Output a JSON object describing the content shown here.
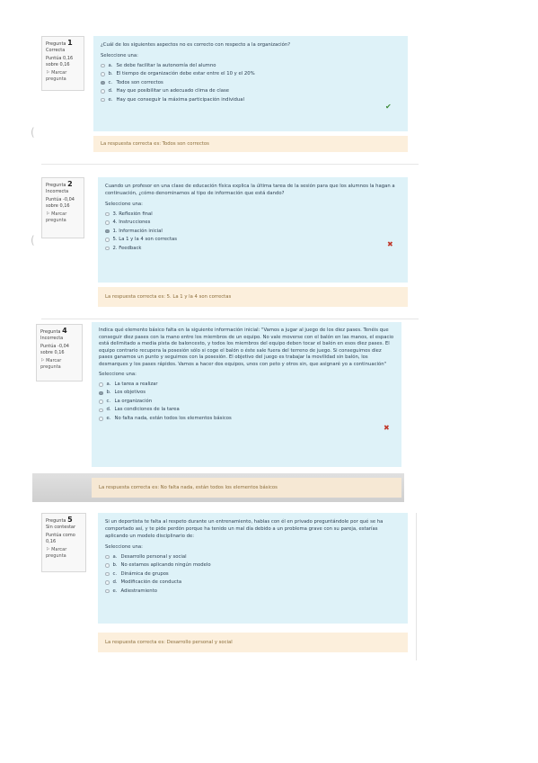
{
  "questions": [
    {
      "number": "1",
      "label": "Pregunta",
      "state": "Correcta",
      "grade": "Puntúa 0,16 sobre 0,16",
      "flag": "Marcar pregunta",
      "prompt": "¿Cuál de los siguientes aspectos no es correcto con respecto a la organización?",
      "select_label": "Seleccione una:",
      "options": [
        {
          "letter": "a.",
          "text": "Se debe facilitar la autonomía del alumno"
        },
        {
          "letter": "b.",
          "text": "El tiempo de organización debe estar entre el 10 y el 20%"
        },
        {
          "letter": "c.",
          "text": "Todos son correctos"
        },
        {
          "letter": "d.",
          "text": "Hay que posibilitar un adecuado clima de clase"
        },
        {
          "letter": "e.",
          "text": "Hay que conseguir la máxima participación individual"
        }
      ],
      "mark": "✔",
      "feedback": "La respuesta correcta es: Todos son correctos"
    },
    {
      "number": "2",
      "label": "Pregunta",
      "state": "Incorrecta",
      "grade": "Puntúa -0,04 sobre 0,16",
      "flag": "Marcar pregunta",
      "prompt": "Cuando un profesor en una clase de educación física explica la última tarea de la sesión para que los alumnos la hagan a continuación, ¿cómo denominamos al tipo de información que está dando?",
      "select_label": "Seleccione una:",
      "options": [
        {
          "letter": "",
          "text": "3. Reflexión final"
        },
        {
          "letter": "",
          "text": "4. Instrucciones"
        },
        {
          "letter": "",
          "text": "1. Información inicial"
        },
        {
          "letter": "",
          "text": "5. La 1 y la 4 son correctas"
        },
        {
          "letter": "",
          "text": "2. Feedback"
        }
      ],
      "mark": "✖",
      "feedback": "La respuesta correcta es: 5. La 1 y la 4 son correctas"
    },
    {
      "number": "4",
      "label": "Pregunta",
      "state": "Incorrecta",
      "grade": "Puntúa -0,04 sobre 0,16",
      "flag": "Marcar pregunta",
      "prompt": "Indica qué elemento básico falta en la siguiente información inicial: \"Vamos a jugar al juego de los diez pases. Tenéis que conseguir diez pases con la mano entre los miembros de un equipo. No vale moverse con el balón en las manos, el espacio está delimitado a media pista de baloncesto, y todos los miembros del equipo deben tocar el balón en esos diez pases. El equipo contrario recupera la posesión sólo si coge el balón o éste sale fuera del terreno de juego. Si conseguimos diez pases ganamos un punto y seguimos con la posesión. El objetivo del juego es trabajar la movilidad sin balón, los desmarques y los pases rápidos. Vamos a hacer dos equipos, unos con peto y otros sin, que asignaré yo a continuación\"",
      "select_label": "Seleccione una:",
      "options": [
        {
          "letter": "a.",
          "text": "La tarea a realizar"
        },
        {
          "letter": "b.",
          "text": "Los objetivos"
        },
        {
          "letter": "c.",
          "text": "La organización"
        },
        {
          "letter": "d.",
          "text": "Las condiciones de la tarea"
        },
        {
          "letter": "e.",
          "text": "No falta nada, están todos los elementos básicos"
        }
      ],
      "mark": "✖",
      "feedback": "La respuesta correcta es: No falta nada, están todos los elementos básicos"
    },
    {
      "number": "5",
      "label": "Pregunta",
      "state": "Sin contestar",
      "grade": "Puntúa como 0,16",
      "flag": "Marcar pregunta",
      "prompt": "Si un deportista te falta al respeto durante un entrenamiento, hablas con él en privado preguntándole por qué se ha comportado así, y te pide perdón porque ha tenido un mal día debido a un problema grave con su pareja, estarías aplicando un modelo disciplinario de:",
      "select_label": "Seleccione una:",
      "options": [
        {
          "letter": "a.",
          "text": "Desarrollo personal y social"
        },
        {
          "letter": "b.",
          "text": "No estamos aplicando ningún modelo"
        },
        {
          "letter": "c.",
          "text": "Dinámica de grupos"
        },
        {
          "letter": "d.",
          "text": "Modificación de conducta"
        },
        {
          "letter": "e.",
          "text": "Adiestramiento"
        }
      ],
      "mark": "",
      "feedback": "La respuesta correcta es: Desarrollo personal y social"
    }
  ],
  "selected": [
    2,
    2,
    1,
    -1
  ],
  "colors": {
    "content_bg": "#def2f8",
    "feedback_bg": "#fcefdc",
    "correct": "#3d8b37",
    "incorrect": "#c0392b"
  }
}
